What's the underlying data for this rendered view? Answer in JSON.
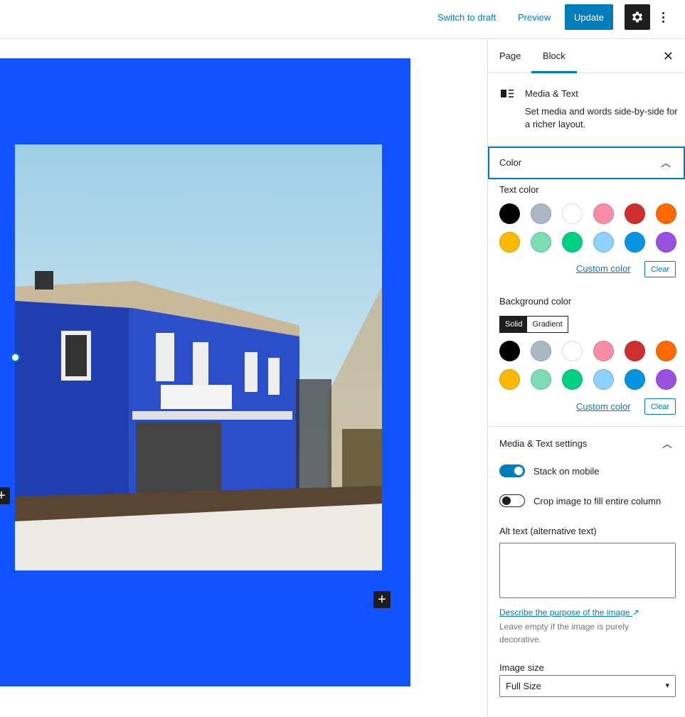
{
  "topbar": {
    "switch_to_draft": "Switch to draft",
    "preview": "Preview",
    "update": "Update"
  },
  "sidebar": {
    "tabs": [
      {
        "label": "Page"
      },
      {
        "label": "Block"
      }
    ],
    "active_tab": "Block",
    "block_card": {
      "icon": "media-text-icon",
      "title": "Media & Text",
      "description": "Set media and words side-by-side for a richer layout."
    },
    "color_panel": {
      "title": "Color",
      "text_color_label": "Text color",
      "background_color_label": "Background color",
      "palette": [
        "#000000",
        "#abb8c3",
        "#ffffff",
        "#f78da7",
        "#cf2e2e",
        "#ff6900",
        "#fcb900",
        "#7bdcb5",
        "#00d084",
        "#8ed1fc",
        "#0693e3",
        "#9b51e0"
      ],
      "custom_color": "Custom color",
      "clear": "Clear",
      "bg_modes": [
        "Solid",
        "Gradient"
      ],
      "bg_mode_selected": "Solid"
    },
    "settings_panel": {
      "title": "Media & Text settings",
      "stack_on_mobile": {
        "label": "Stack on mobile",
        "checked": true
      },
      "crop_image": {
        "label": "Crop image to fill entire column",
        "checked": false
      },
      "alt_text_label": "Alt text (alternative text)",
      "alt_text_value": "",
      "help_link": "Describe the purpose of the image",
      "help_text": "Leave empty if the image is purely decorative.",
      "image_size_label": "Image size",
      "image_size_value": "Full Size"
    }
  },
  "canvas": {
    "block_background": "#1352ff",
    "accent": "#007cba"
  }
}
